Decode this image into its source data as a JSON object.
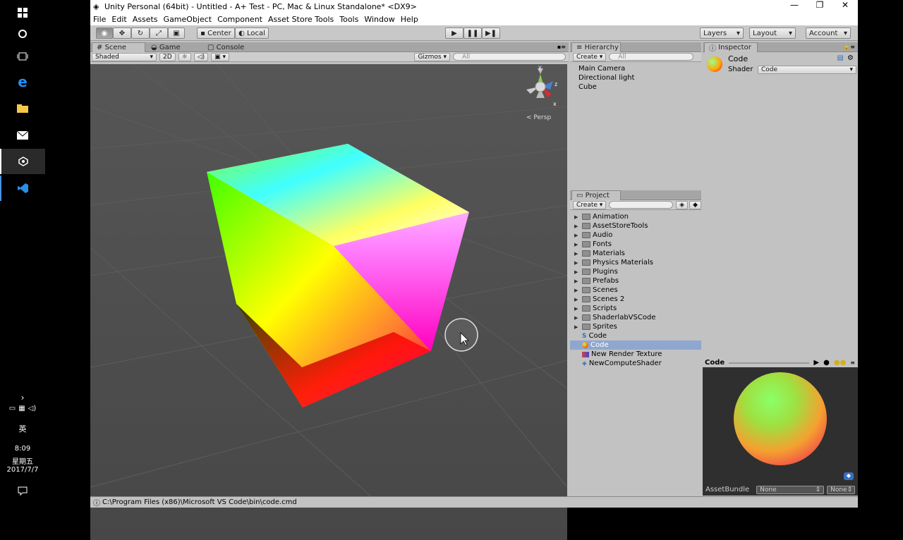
{
  "window": {
    "title": "Unity Personal (64bit) - Untitled - A+ Test - PC, Mac & Linux Standalone* <DX9>",
    "minimize": "—",
    "maximize": "❐",
    "close": "✕"
  },
  "menu": [
    "File",
    "Edit",
    "Assets",
    "GameObject",
    "Component",
    "Asset Store Tools",
    "Tools",
    "Window",
    "Help"
  ],
  "toolbar": {
    "pivot": "Center",
    "space": "Local",
    "layers": "Layers",
    "layout": "Layout",
    "account": "Account"
  },
  "scene": {
    "tabs": [
      "Scene",
      "Game",
      "Console"
    ],
    "shading": "Shaded",
    "mode2d": "2D",
    "gizmos": "Gizmos",
    "search_placeholder": "All",
    "persp": "Persp",
    "axis_y": "y",
    "axis_z": "z",
    "axis_x": "x"
  },
  "hierarchy": {
    "tab": "Hierarchy",
    "create": "Create",
    "search_placeholder": "All",
    "items": [
      "Main Camera",
      "Directional light",
      "Cube"
    ]
  },
  "project": {
    "tab": "Project",
    "create": "Create",
    "folders": [
      "Animation",
      "AssetStoreTools",
      "Audio",
      "Fonts",
      "Materials",
      "Physics Materials",
      "Plugins",
      "Prefabs",
      "Scenes",
      "Scenes 2",
      "Scripts",
      "ShaderlabVSCode",
      "Sprites"
    ],
    "files": [
      "Code",
      "Code",
      "New Render Texture",
      "NewComputeShader"
    ],
    "selected_index": 1
  },
  "inspector": {
    "tab": "Inspector",
    "name": "Code",
    "shader_label": "Shader",
    "shader_value": "Code"
  },
  "preview": {
    "title": "Code",
    "assetbundle_label": "AssetBundle",
    "assetbundle_value": "None",
    "variant_value": "None"
  },
  "status": {
    "text": "C:\\Program Files (x86)\\Microsoft VS Code\\bin\\code.cmd"
  },
  "system": {
    "ime": "英",
    "time": "8:09",
    "weekday": "星期五",
    "date": "2017/7/7"
  },
  "colors": {
    "editor_bg": "#c2c2c2",
    "scene_bg": "#4f4f4f",
    "selected": "#8fa7cf"
  }
}
